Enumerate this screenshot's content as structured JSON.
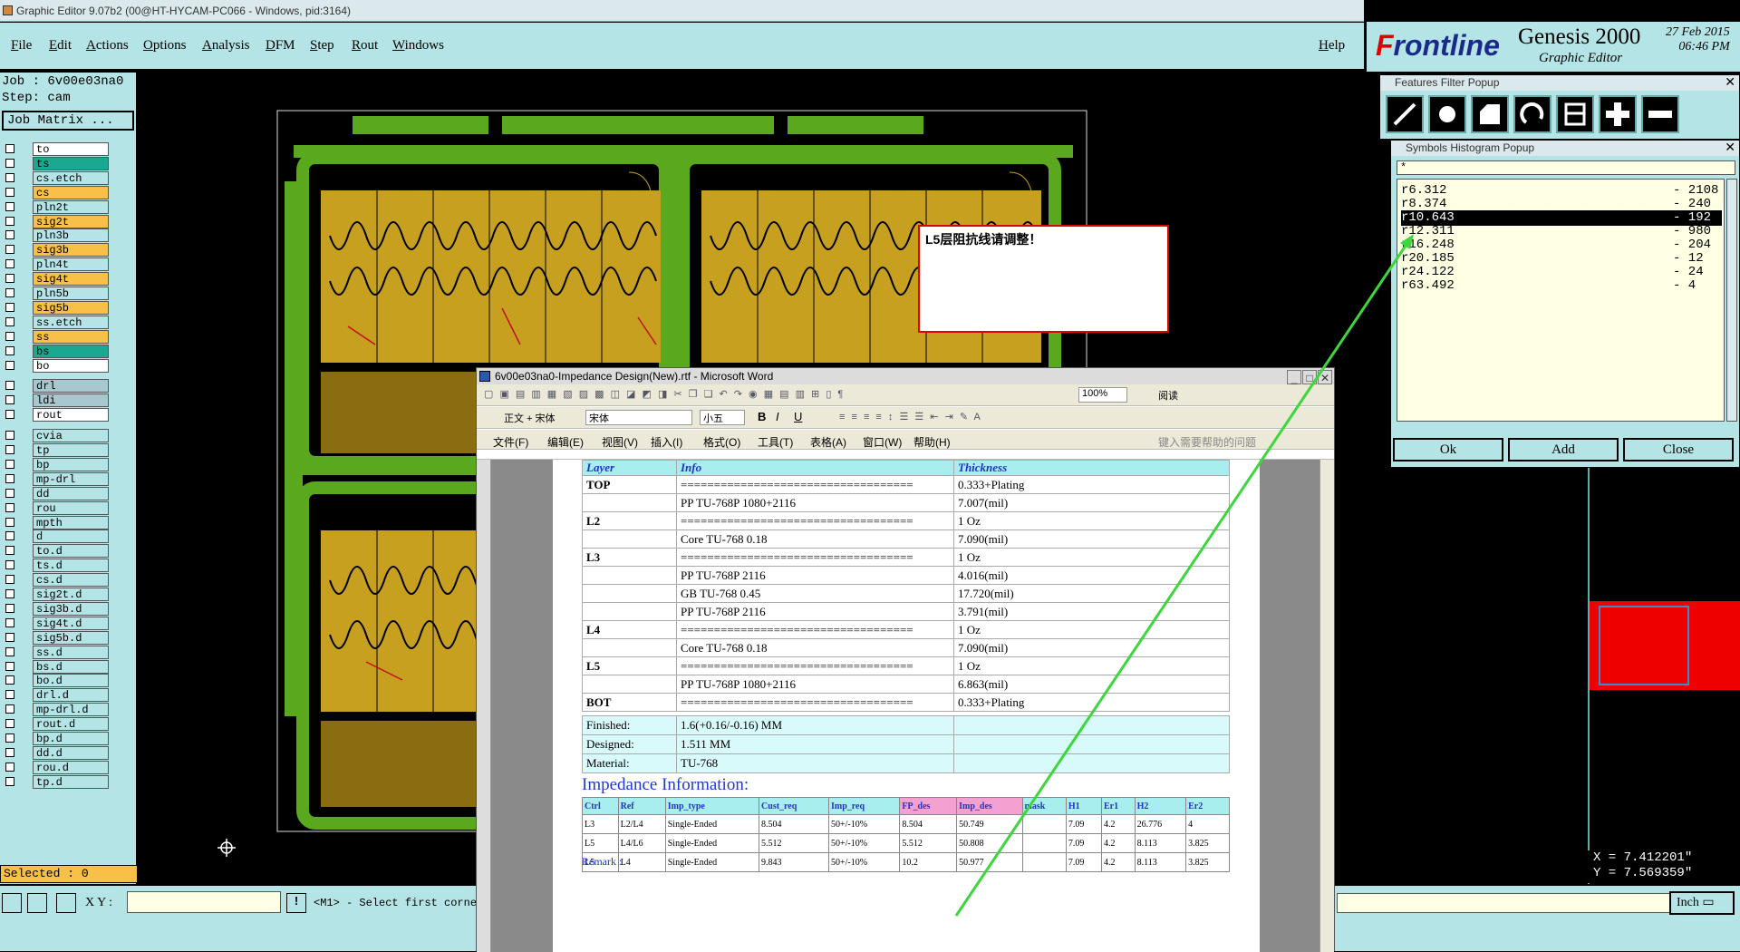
{
  "window": {
    "title": "Graphic Editor 9.07b2 (00@HT-HYCAM-PC066 - Windows, pid:3164)"
  },
  "menu": {
    "file": "File",
    "edit": "Edit",
    "actions": "Actions",
    "options": "Options",
    "analysis": "Analysis",
    "dfm": "DFM",
    "step": "Step",
    "rout": "Rout",
    "windows": "Windows",
    "help": "Help"
  },
  "brand": {
    "logo_a": "F",
    "logo_b": "rontline",
    "product": "Genesis 2000",
    "subtitle": "Graphic Editor",
    "date": "27 Feb 2015",
    "time": "06:46 PM"
  },
  "job": {
    "job": "Job : 6v00e03na0",
    "step": "Step: cam",
    "matrix_button": "Job Matrix ...",
    "selected": "Selected : 0"
  },
  "layers": [
    {
      "name": "to",
      "color": "#ffffff"
    },
    {
      "name": "ts",
      "color": "#1aa890"
    },
    {
      "name": "cs.etch",
      "color": "#b4e4e6"
    },
    {
      "name": "cs",
      "color": "#f8c048"
    },
    {
      "name": "pln2t",
      "color": "#b4e4e6"
    },
    {
      "name": "sig2t",
      "color": "#f8c048"
    },
    {
      "name": "pln3b",
      "color": "#b4e4e6"
    },
    {
      "name": "sig3b",
      "color": "#f8c048"
    },
    {
      "name": "pln4t",
      "color": "#b4e4e6"
    },
    {
      "name": "sig4t",
      "color": "#f8c048"
    },
    {
      "name": "pln5b",
      "color": "#b4e4e6"
    },
    {
      "name": "sig5b",
      "color": "#f8c048"
    },
    {
      "name": "ss.etch",
      "color": "#b4e4e6"
    },
    {
      "name": "ss",
      "color": "#f8c048"
    },
    {
      "name": "bs",
      "color": "#1aa890"
    },
    {
      "name": "bo",
      "color": "#ffffff"
    },
    {
      "name": "drl",
      "color": "#a8c8d0"
    },
    {
      "name": "ldi",
      "color": "#a8c8d0"
    },
    {
      "name": "rout",
      "color": "#ffffff"
    },
    {
      "name": "cvia",
      "color": "#b4e4e6"
    },
    {
      "name": "tp",
      "color": "#b4e4e6"
    },
    {
      "name": "bp",
      "color": "#b4e4e6"
    },
    {
      "name": "mp-drl",
      "color": "#b4e4e6"
    },
    {
      "name": "dd",
      "color": "#b4e4e6"
    },
    {
      "name": "rou",
      "color": "#b4e4e6"
    },
    {
      "name": "mpth",
      "color": "#b4e4e6"
    },
    {
      "name": "d",
      "color": "#b4e4e6"
    },
    {
      "name": "to.d",
      "color": "#b4e4e6"
    },
    {
      "name": "ts.d",
      "color": "#b4e4e6"
    },
    {
      "name": "cs.d",
      "color": "#b4e4e6"
    },
    {
      "name": "sig2t.d",
      "color": "#b4e4e6"
    },
    {
      "name": "sig3b.d",
      "color": "#b4e4e6"
    },
    {
      "name": "sig4t.d",
      "color": "#b4e4e6"
    },
    {
      "name": "sig5b.d",
      "color": "#b4e4e6"
    },
    {
      "name": "ss.d",
      "color": "#b4e4e6"
    },
    {
      "name": "bs.d",
      "color": "#b4e4e6"
    },
    {
      "name": "bo.d",
      "color": "#b4e4e6"
    },
    {
      "name": "drl.d",
      "color": "#b4e4e6"
    },
    {
      "name": "mp-drl.d",
      "color": "#b4e4e6"
    },
    {
      "name": "rout.d",
      "color": "#b4e4e6"
    },
    {
      "name": "bp.d",
      "color": "#b4e4e6"
    },
    {
      "name": "dd.d",
      "color": "#b4e4e6"
    },
    {
      "name": "rou.d",
      "color": "#b4e4e6"
    },
    {
      "name": "tp.d",
      "color": "#b4e4e6"
    }
  ],
  "features_filter": {
    "title": "Features Filter Popup"
  },
  "histogram": {
    "title": "Symbols Histogram Popup",
    "filter": "*",
    "rows": [
      {
        "sym": "r6.312",
        "count": "- 2108"
      },
      {
        "sym": "r8.374",
        "count": "- 240"
      },
      {
        "sym": "r10.643",
        "count": "- 192"
      },
      {
        "sym": "r12.311",
        "count": "- 980"
      },
      {
        "sym": "r16.248",
        "count": "- 204"
      },
      {
        "sym": "r20.185",
        "count": "- 12"
      },
      {
        "sym": "r24.122",
        "count": "- 24"
      },
      {
        "sym": "r63.492",
        "count": "- 4"
      }
    ],
    "ok": "Ok",
    "add": "Add",
    "close": "Close"
  },
  "note": {
    "text": "L5层阻抗线请调整！"
  },
  "status": {
    "xy_label": "X Y :",
    "xy_value": "",
    "prompt": "<M1> - Select first corne",
    "units": "Inch",
    "x": "X = 7.412201\"",
    "y": "Y = 7.569359\""
  },
  "word": {
    "title": "6v00e03na0-Impedance Design(New).rtf - Microsoft Word",
    "zoom": "100%",
    "read": "阅读",
    "style": "正文 + 宋体",
    "font": "宋体",
    "size": "小五",
    "menus": {
      "file": "文件(F)",
      "edit": "编辑(E)",
      "view": "视图(V)",
      "insert": "插入(I)",
      "format": "格式(O)",
      "tools": "工具(T)",
      "table": "表格(A)",
      "window": "窗口(W)",
      "help": "帮助(H)",
      "ask": "键入需要帮助的问题"
    },
    "stackup_headers": {
      "layer": "Layer",
      "info": "Info",
      "thickness": "Thickness"
    },
    "stackup": [
      {
        "layer": "TOP",
        "info": "===================================",
        "thk": "0.333+Plating"
      },
      {
        "layer": "",
        "info": "PP    TU-768P   1080+2116",
        "thk": "7.007(mil)"
      },
      {
        "layer": "L2",
        "info": "===================================",
        "thk": "1 Oz"
      },
      {
        "layer": "",
        "info": "Core    TU-768    0.18",
        "thk": "7.090(mil)"
      },
      {
        "layer": "L3",
        "info": "===================================",
        "thk": "1 Oz"
      },
      {
        "layer": "",
        "info": "PP    TU-768P    2116",
        "thk": "4.016(mil)"
      },
      {
        "layer": "",
        "info": "GB    TU-768    0.45",
        "thk": "17.720(mil)"
      },
      {
        "layer": "",
        "info": "PP    TU-768P    2116",
        "thk": "3.791(mil)"
      },
      {
        "layer": "L4",
        "info": "===================================",
        "thk": "1 Oz"
      },
      {
        "layer": "",
        "info": "Core    TU-768    0.18",
        "thk": "7.090(mil)"
      },
      {
        "layer": "L5",
        "info": "===================================",
        "thk": "1 Oz"
      },
      {
        "layer": "",
        "info": "PP    TU-768P   1080+2116",
        "thk": "6.863(mil)"
      },
      {
        "layer": "BOT",
        "info": "===================================",
        "thk": "0.333+Plating"
      }
    ],
    "finished_label": "Finished:",
    "finished": "1.6(+0.16/-0.16) MM",
    "designed_label": "Designed:",
    "designed": "1.511 MM",
    "material_label": "Material:",
    "material": "TU-768",
    "imp_title": "Impedance Information:",
    "imp_headers": [
      "Ctrl",
      "Ref",
      "Imp_type",
      "Cust_req",
      "Imp_req",
      "FP_des",
      "Imp_des",
      "mask",
      "H1",
      "Er1",
      "H2",
      "Er2"
    ],
    "imp_rows": [
      [
        "L3",
        "L2/L4",
        "Single-Ended",
        "8.504",
        "50+/-10%",
        "8.504",
        "50.749",
        "",
        "7.09",
        "4.2",
        "26.776",
        "4"
      ],
      [
        "L5",
        "L4/L6",
        "Single-Ended",
        "5.512",
        "50+/-10%",
        "5.512",
        "50.808",
        "",
        "7.09",
        "4.2",
        "8.113",
        "3.825"
      ],
      [
        "L5",
        "L4",
        "Single-Ended",
        "9.843",
        "50+/-10%",
        "10.2",
        "50.977",
        "",
        "7.09",
        "4.2",
        "8.113",
        "3.825"
      ]
    ],
    "remark": "Remark :"
  }
}
